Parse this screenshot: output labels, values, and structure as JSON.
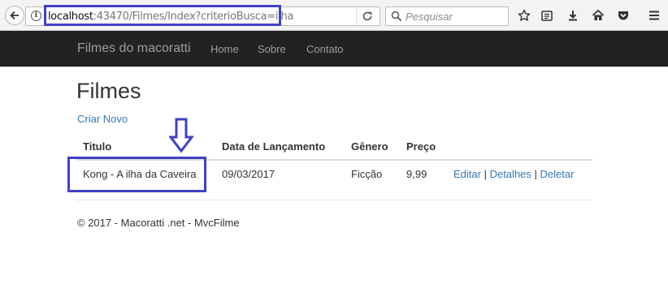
{
  "browser": {
    "url_host": "localhost",
    "url_rest": ":43470/Filmes/Index?criterioBusca=ilha",
    "search_placeholder": "Pesquisar",
    "icons": [
      "back-arrow-icon",
      "info-icon",
      "reload-icon",
      "search-icon",
      "star-icon",
      "reading-list-icon",
      "download-icon",
      "home-icon",
      "pocket-icon",
      "menu-icon"
    ]
  },
  "navbar": {
    "brand": "Filmes do macoratti",
    "links": [
      "Home",
      "Sobre",
      "Contato"
    ]
  },
  "main": {
    "title": "Filmes",
    "create_link": "Criar Novo",
    "table": {
      "headers": [
        "Titulo",
        "Data de Lançamento",
        "Gênero",
        "Preço"
      ],
      "rows": [
        {
          "titulo": "Kong - A ilha da Caveira",
          "data": "09/03/2017",
          "genero": "Ficção",
          "preco": "9,99",
          "actions": [
            "Editar",
            "Detalhes",
            "Deletar"
          ]
        }
      ]
    }
  },
  "footer": "© 2017 - Macoratti .net - MvcFilme",
  "colors": {
    "annotation": "#3f41c6",
    "link": "#337ab7",
    "navbar_bg": "#222222"
  }
}
